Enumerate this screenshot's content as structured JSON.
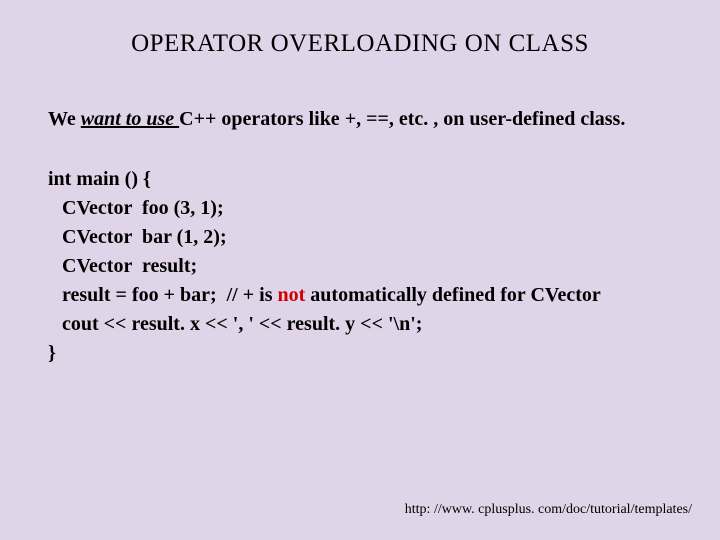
{
  "title": "OPERATOR OVERLOADING ON CLASS",
  "intro": {
    "pre": "We ",
    "underlined": "want to use ",
    "post": "C++ operators like +, ==, etc. , on user-defined class."
  },
  "code": {
    "l1": "int main () {",
    "l2": "CVector  foo (3, 1);",
    "l3": "CVector  bar (1, 2);",
    "l4": "CVector  result;",
    "l5a": "result = foo + bar;  // + is ",
    "l5red": "not",
    "l5b": " automatically defined for CVector",
    "l6": "cout << result. x << ', ' << result. y << '\\n';",
    "l7": "}"
  },
  "footer": "http: //www. cplusplus. com/doc/tutorial/templates/"
}
